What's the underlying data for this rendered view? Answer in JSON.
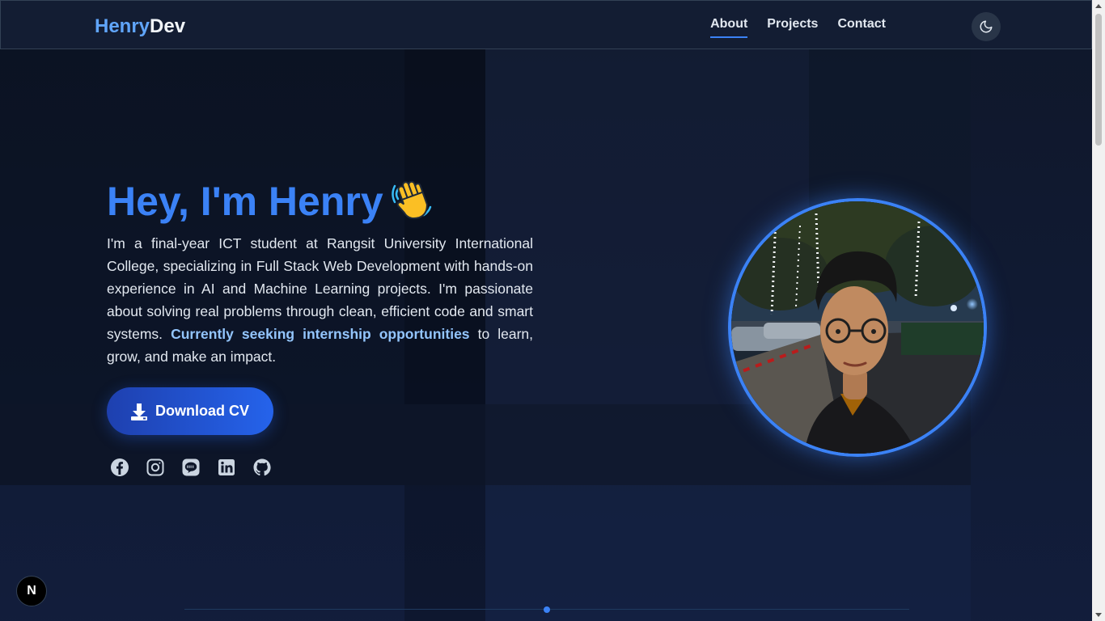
{
  "nav": {
    "brand_part1": "Henry",
    "brand_part2": "Dev",
    "links": [
      "About",
      "Projects",
      "Contact"
    ],
    "active_link": "About",
    "theme_toggle_icon": "moon-icon"
  },
  "hero": {
    "title": "Hey, I'm Henry",
    "wave_icon": "waving-hand-icon",
    "bio_part1": "I'm a final-year ICT student at Rangsit University International College, specializing in Full Stack Web Development with hands-on experience in AI and Machine Learning projects. I'm passionate about solving real problems through clean, efficient code and smart systems. ",
    "bio_highlight": "Currently seeking internship opportunities",
    "bio_part2": " to learn, grow, and make an impact.",
    "cv_button_label": "Download CV",
    "social_icons": [
      "facebook-icon",
      "instagram-icon",
      "line-icon",
      "linkedin-icon",
      "github-icon"
    ]
  },
  "overlay": {
    "next_badge": "N"
  },
  "colors": {
    "accent": "#3b82f6",
    "highlight": "#93c5fd",
    "background": "#0f172a"
  }
}
